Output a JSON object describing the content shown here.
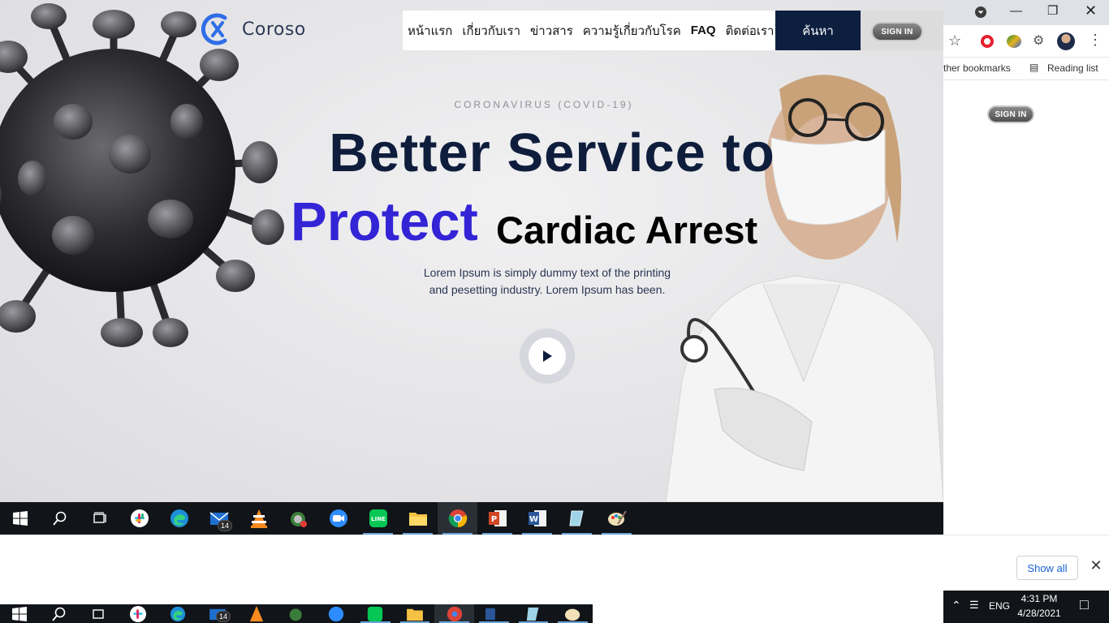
{
  "site": {
    "logo_text": "Coroso",
    "nav": [
      "หน้าแรก",
      "เกี่ยวกับเรา",
      "ข่าวสาร",
      "ความรู้เกี่ยวกับโรค",
      "FAQ",
      "ติดต่อเรา"
    ],
    "search_label": "ค้นหา",
    "signin_label": "SIGN IN",
    "eyebrow": "CORONAVIRUS (COVID-19)",
    "headline_line1": "Better Service to",
    "headline_protect": "Protect",
    "headline_overlay": "Cardiac Arrest",
    "description_line1": "Lorem Ipsum is simply dummy text of the printing",
    "description_line2": "and pesetting industry. Lorem Ipsum has been."
  },
  "browser": {
    "bookmarks_partial": "ther bookmarks",
    "reading_list": "Reading list",
    "side_signin_label": "SIGN IN"
  },
  "downloads": {
    "show_all": "Show all"
  },
  "taskbar": {
    "mail_badge": "14",
    "mail_badge2": "14",
    "icons": [
      "start-icon",
      "search-icon",
      "task-view-icon",
      "slack-icon",
      "edge-icon",
      "mail-icon",
      "vlc-icon",
      "app-icon",
      "zoom-icon",
      "line-icon",
      "file-explorer-icon",
      "chrome-icon",
      "powerpoint-icon",
      "word-icon",
      "notepad-icon",
      "paint-icon"
    ]
  },
  "tray": {
    "language": "ENG",
    "time": "4:31 PM",
    "date": "4/28/2021"
  },
  "colors": {
    "navy": "#0f1d3c",
    "purple": "#3324d6",
    "search_bg": "#0d1f3f",
    "taskbar": "#111418",
    "link_blue": "#1a62d4"
  }
}
